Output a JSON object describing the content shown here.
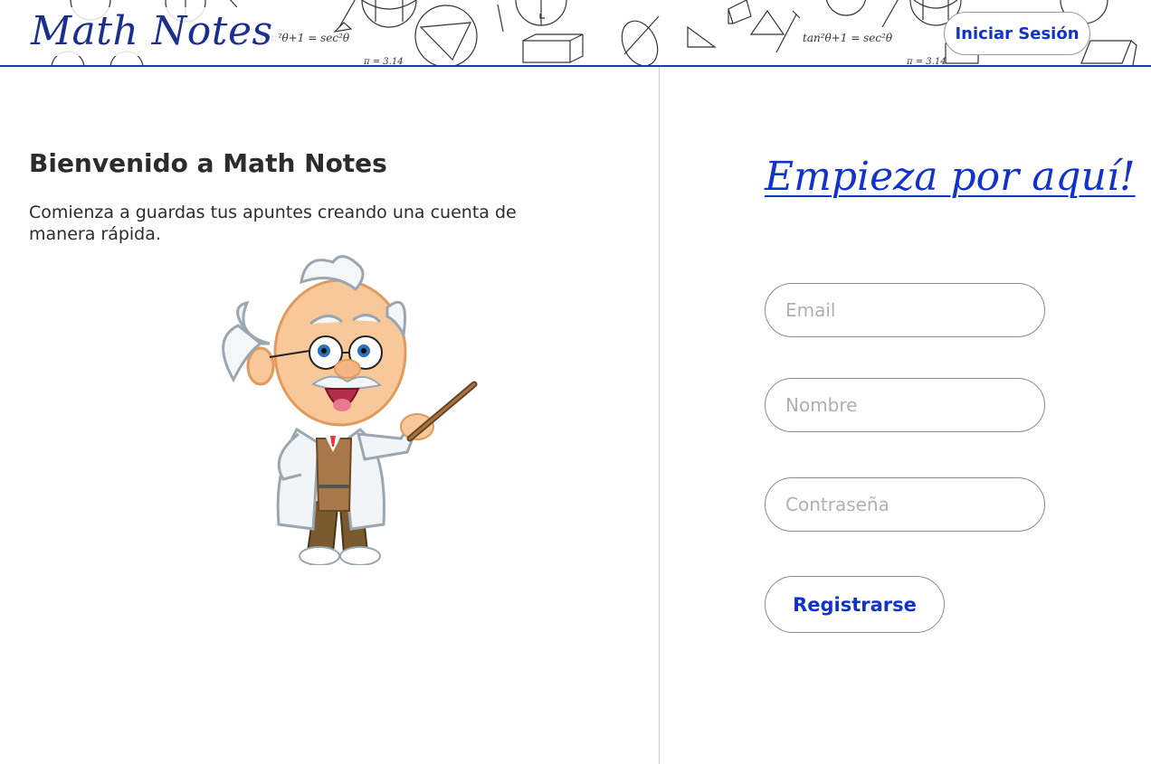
{
  "header": {
    "logo": "Math Notes",
    "login_label": "Iniciar Sesión",
    "doodle_texts": {
      "formula_1": "tan²θ+1 = sec²θ",
      "formula_2": "tan²θ+1 = sec²θ",
      "pi_1": "π = 3.14",
      "pi_2": "π = 3.14"
    }
  },
  "left": {
    "title": "Bienvenido a Math Notes",
    "description": "Comienza a guardas tus apuntes creando una cuenta de manera rápida."
  },
  "right": {
    "start_link": "Empieza por aquí!",
    "email_placeholder": "Email",
    "name_placeholder": "Nombre",
    "password_placeholder": "Contraseña",
    "register_label": "Registrarse"
  },
  "colors": {
    "brand": "#1b2f8f",
    "accent": "#1133cc",
    "header_border": "#1a3ab5"
  },
  "icons": {
    "header_decoration": "math-doodles-icon",
    "mascot": "professor-illustration"
  }
}
